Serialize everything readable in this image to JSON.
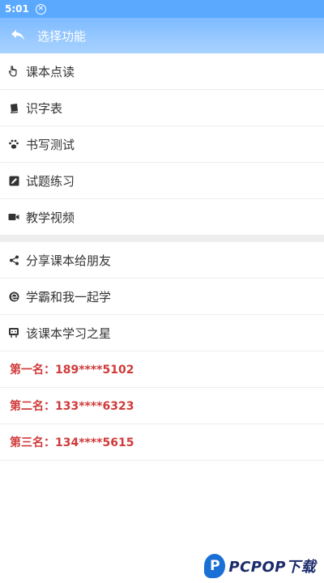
{
  "status": {
    "time": "5:01"
  },
  "header": {
    "title": "选择功能"
  },
  "menu": [
    {
      "label": "课本点读",
      "icon": "pointer-hand-icon"
    },
    {
      "label": "识字表",
      "icon": "book-icon"
    },
    {
      "label": "书写测试",
      "icon": "paw-icon"
    },
    {
      "label": "试题练习",
      "icon": "edit-icon"
    },
    {
      "label": "教学视频",
      "icon": "video-icon"
    }
  ],
  "social": [
    {
      "label": "分享课本给朋友",
      "icon": "share-icon"
    },
    {
      "label": "学霸和我一起学",
      "icon": "edge-icon"
    },
    {
      "label": "该课本学习之星",
      "icon": "star-icon"
    }
  ],
  "ranks": [
    "第一名：189****5102",
    "第二名：133****6323",
    "第三名：134****5615"
  ],
  "watermark": {
    "text": "PCPOP下载"
  },
  "colors": {
    "header": "#7dbbff",
    "rank": "#d03a3a"
  }
}
